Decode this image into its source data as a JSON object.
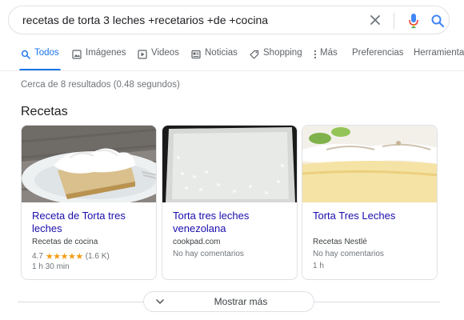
{
  "search": {
    "query": "recetas de torta 3 leches +recetarios +de +cocina"
  },
  "tabs": [
    {
      "label": "Todos",
      "icon": "search-icon"
    },
    {
      "label": "Imágenes",
      "icon": "image-icon"
    },
    {
      "label": "Videos",
      "icon": "video-icon"
    },
    {
      "label": "Noticias",
      "icon": "news-icon"
    },
    {
      "label": "Shopping",
      "icon": "tag-icon"
    },
    {
      "label": "Más",
      "icon": "more-vert-icon"
    },
    {
      "label": "Preferencias"
    },
    {
      "label": "Herramientas"
    }
  ],
  "result_stats": "Cerca de 8 resultados (0.48 segundos)",
  "section_title": "Recetas",
  "cards": [
    {
      "title": "Receta de Torta tres leches",
      "source": "Recetas de cocina",
      "rating": "4.7",
      "stars": "★★★★★",
      "reviews": "(1.6 K)",
      "time": "1 h 30 min"
    },
    {
      "title": "Torta tres leches venezolana",
      "source": "cookpad.com",
      "comments": "No hay comentarios"
    },
    {
      "title": "Torta Tres Leches",
      "source": "Recetas Nestlé",
      "comments": "No hay comentarios",
      "time": "1 h"
    }
  ],
  "show_more": "Mostrar más",
  "colors": {
    "link": "#1a0dab",
    "accent": "#1a73e8",
    "star": "#f39c12"
  }
}
